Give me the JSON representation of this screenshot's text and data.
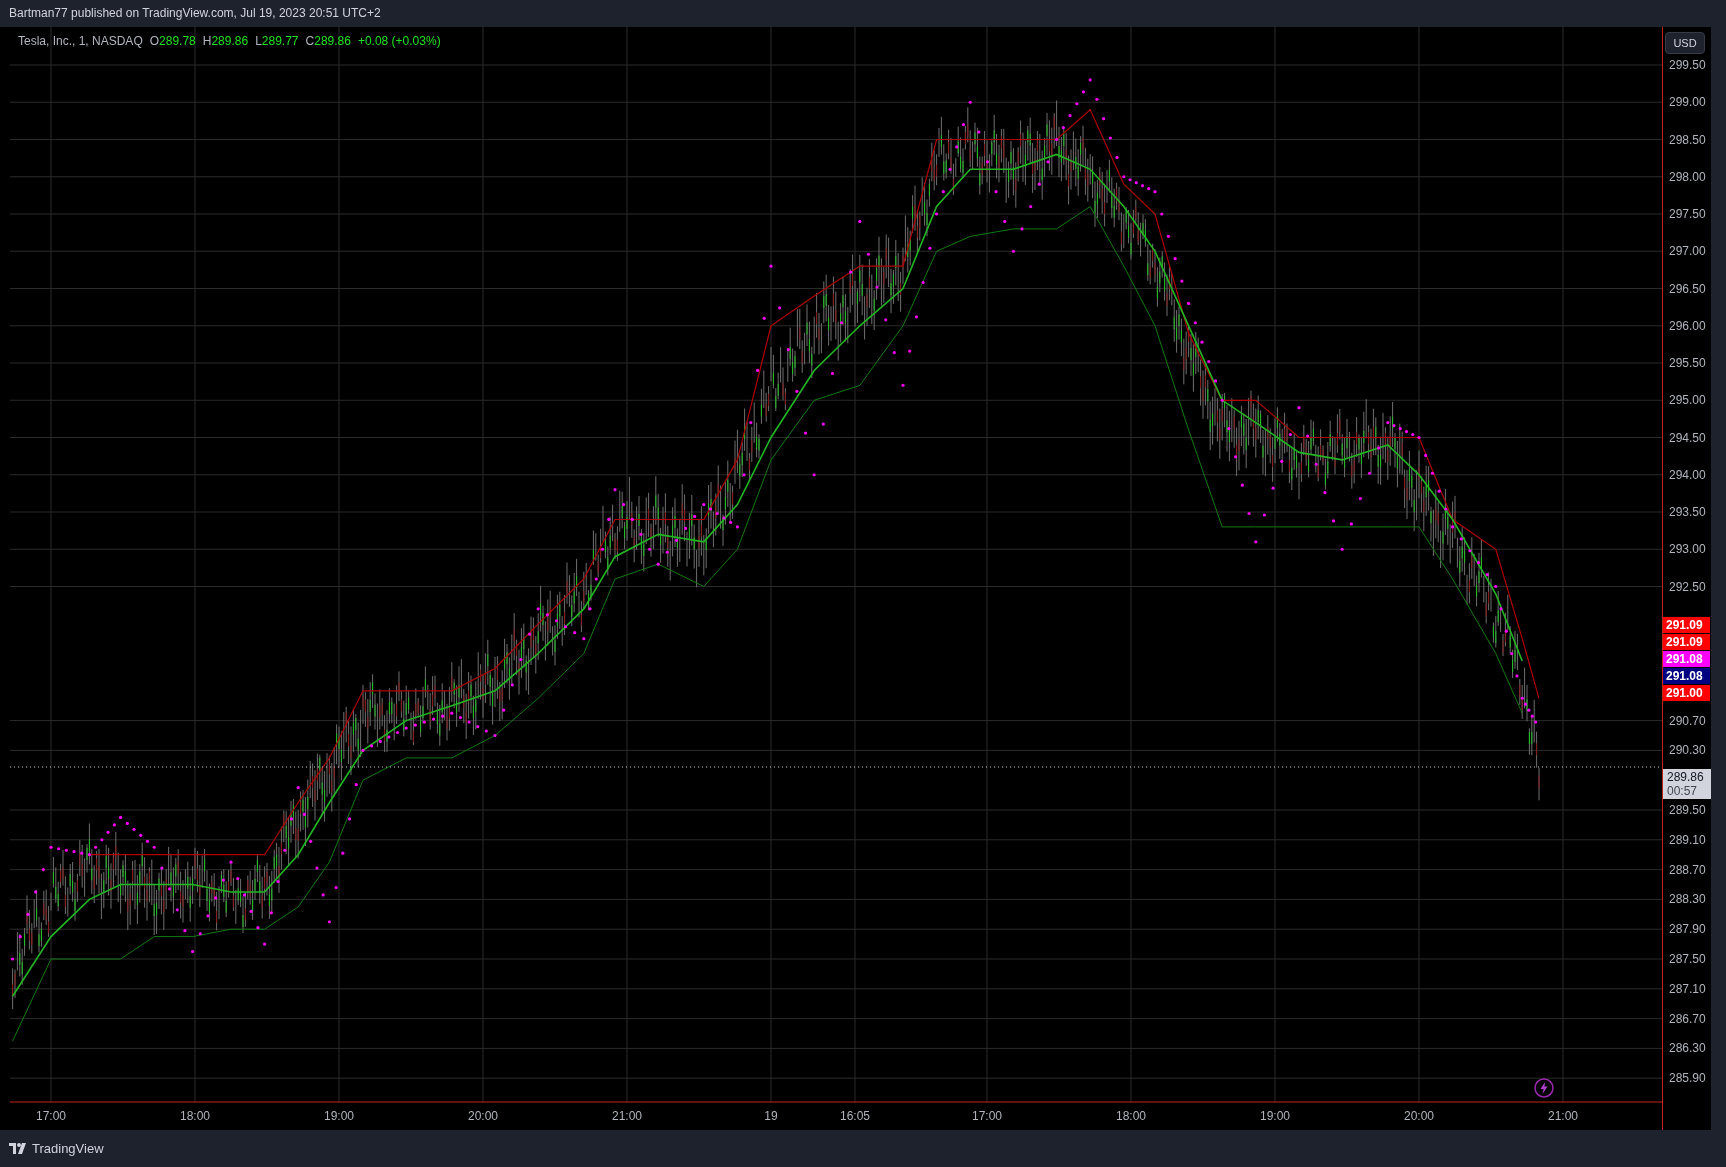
{
  "header": {
    "text": "Bartman77 published on TradingView.com, Jul 19, 2023 20:51 UTC+2"
  },
  "legend": {
    "symbol": "Tesla, Inc., 1, NASDAQ",
    "values": [
      {
        "label": "O",
        "value": "289.78"
      },
      {
        "label": "H",
        "value": "289.86"
      },
      {
        "label": "L",
        "value": "289.77"
      },
      {
        "label": "C",
        "value": "289.86"
      }
    ],
    "change": "+0.08 (+0.03%)"
  },
  "currency_button": {
    "label": "USD"
  },
  "price_axis": {
    "labels": [
      "299.50",
      "299.00",
      "298.50",
      "298.00",
      "297.50",
      "297.00",
      "296.50",
      "296.00",
      "295.50",
      "295.00",
      "294.50",
      "294.00",
      "293.50",
      "293.00",
      "292.50",
      "290.70",
      "290.30",
      "289.50",
      "289.10",
      "288.70",
      "288.30",
      "287.90",
      "287.50",
      "287.10",
      "286.70",
      "286.30",
      "285.90"
    ]
  },
  "time_axis": {
    "labels": [
      "17:00",
      "18:00",
      "19:00",
      "20:00",
      "21:00",
      "19",
      "16:05",
      "17:00",
      "18:00",
      "19:00",
      "20:00",
      "21:00"
    ]
  },
  "price_labels": [
    {
      "text": "291.09",
      "color": "#ff0000"
    },
    {
      "text": "291.09",
      "color": "#ff0000"
    },
    {
      "text": "291.08",
      "color": "#ff00ff"
    },
    {
      "text": "291.08",
      "color": "#000080"
    },
    {
      "text": "291.00",
      "color": "#ff0000"
    }
  ],
  "last_price": {
    "price": "289.86",
    "countdown": "00:57"
  },
  "footer": {
    "brand": "TradingView"
  }
}
